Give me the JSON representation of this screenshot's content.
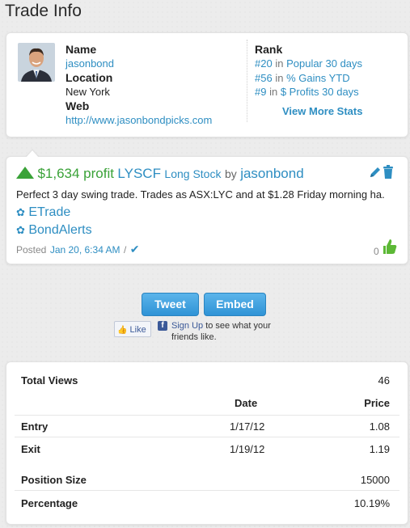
{
  "page": {
    "title": "Trade Info"
  },
  "profile": {
    "name_label": "Name",
    "name": "jasonbond",
    "location_label": "Location",
    "location": "New York",
    "web_label": "Web",
    "web": "http://www.jasonbondpicks.com",
    "rank_label": "Rank",
    "ranks": [
      {
        "pos": "#20",
        "in": "in",
        "list": "Popular 30 days"
      },
      {
        "pos": "#56",
        "in": "in",
        "list": "% Gains YTD"
      },
      {
        "pos": "#9",
        "in": "in",
        "list": "$ Profits 30 days"
      }
    ],
    "view_stats": "View More Stats"
  },
  "trade": {
    "profit": "$1,634 profit",
    "ticker": "LYSCF",
    "kind": "Long Stock",
    "by": "by",
    "author": "jasonbond",
    "description": "Perfect 3 day swing trade. Trades as ASX:LYC and at $1.28 Friday morning ha.",
    "tags": [
      "ETrade",
      "BondAlerts"
    ],
    "posted_label": "Posted",
    "posted_date": "Jan 20, 6:34 AM",
    "separator": "/",
    "likes": "0",
    "colors": {
      "profit": "#3aa238",
      "link": "#2e8ec2"
    }
  },
  "share": {
    "tweet": "Tweet",
    "embed": "Embed",
    "like": "Like",
    "signup": "Sign Up",
    "signup_rest": "to see what your friends like."
  },
  "stats": {
    "total_views_label": "Total Views",
    "total_views": "46",
    "headers": {
      "date": "Date",
      "price": "Price"
    },
    "entry": {
      "label": "Entry",
      "date": "1/17/12",
      "price": "1.08"
    },
    "exit": {
      "label": "Exit",
      "date": "1/19/12",
      "price": "1.19"
    },
    "position_size_label": "Position Size",
    "position_size": "15000",
    "percentage_label": "Percentage",
    "percentage": "10.19%"
  }
}
